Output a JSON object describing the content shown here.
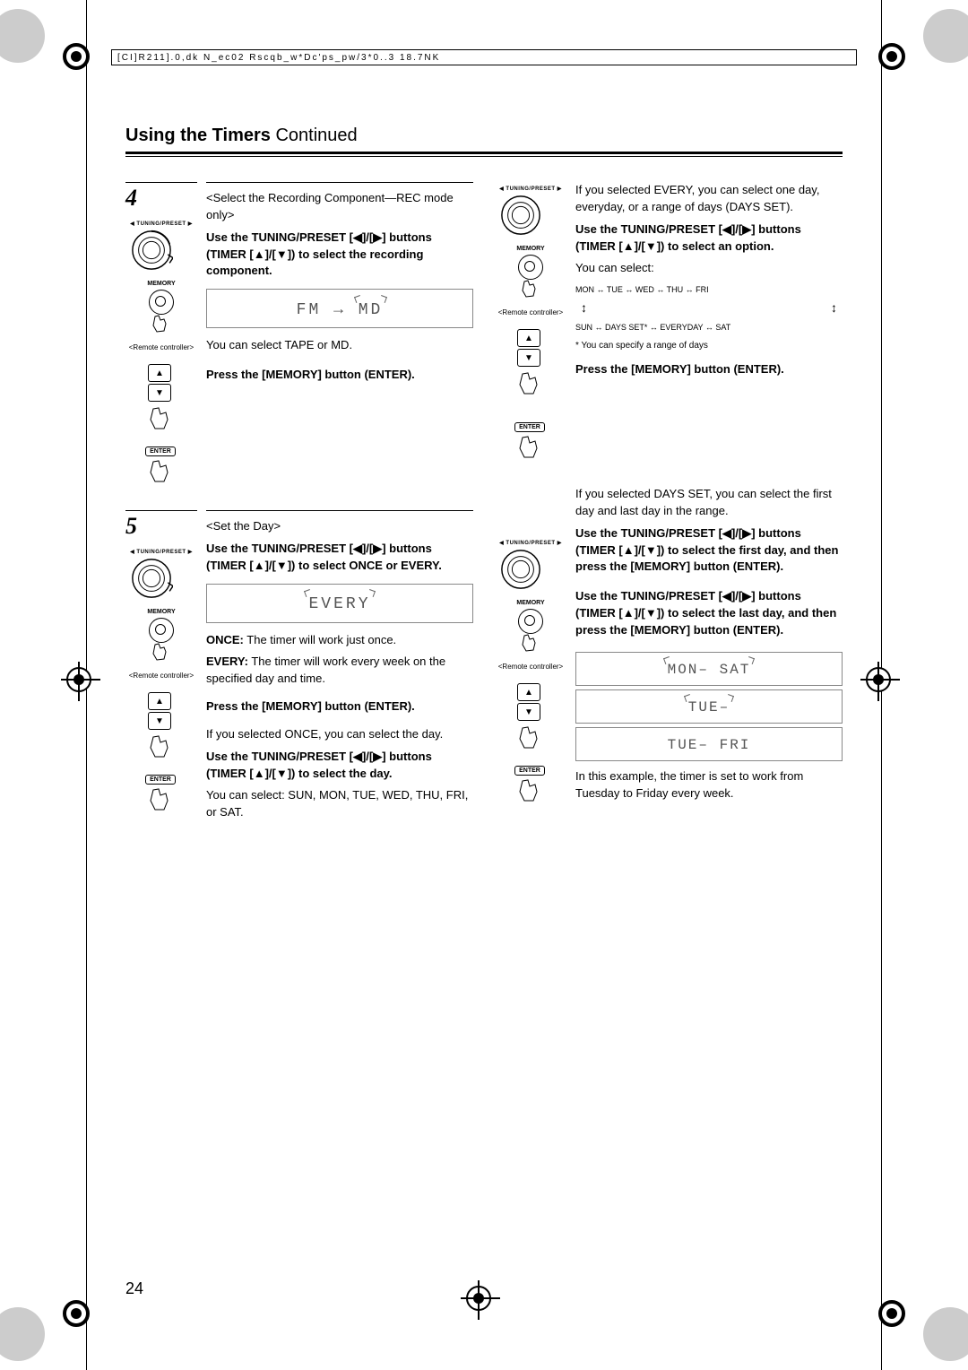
{
  "meta": {
    "filepath": "[CI]R211].0,dk N_ec02 Rscqb_w*Dc'ps_pw/3*0..3 18.7NK"
  },
  "header": {
    "title_bold": "Using the Timers",
    "title_cont": "Continued"
  },
  "step4": {
    "number": "4",
    "subtitle": "<Select the Recording Component—REC mode only>",
    "line1": "Use the TUNING/PRESET [◀]/[▶] buttons (TIMER [▲]/[▼]) to select the recording component.",
    "lcd1_left": "FM",
    "lcd1_arrow": "→",
    "lcd1_right": "MD",
    "note": "You can select TAPE or MD.",
    "press": "Press the [MEMORY] button (ENTER).",
    "tuning_label": "◀ TUNING/PRESET ▶",
    "memory_label": "MEMORY",
    "remote_label": "<Remote controller>",
    "enter_label": "ENTER"
  },
  "step5": {
    "number": "5",
    "subtitle": "<Set the Day>",
    "line1": "Use the TUNING/PRESET [◀]/[▶] buttons (TIMER [▲]/[▼]) to select ONCE or EVERY.",
    "lcd": "EVERY",
    "once_label": "ONCE:",
    "once_text": "The timer will work just once.",
    "every_label": "EVERY:",
    "every_text": "The timer will work every week on the specified day and time.",
    "press": "Press the [MEMORY] button (ENTER).",
    "once_sel": "If you selected ONCE, you can select the day.",
    "once_sel_bold": "Use the TUNING/PRESET [◀]/[▶] buttons (TIMER [▲]/[▼]) to select the day.",
    "once_sel_days": "You can select: SUN, MON, TUE, WED, THU, FRI, or SAT.",
    "tuning_label": "◀ TUNING/PRESET ▶",
    "memory_label": "MEMORY",
    "remote_label": "<Remote controller>",
    "enter_label": "ENTER"
  },
  "right_every": {
    "intro": "If you selected EVERY, you can select one day, everyday, or a range of days (DAYS SET).",
    "line1": "Use the TUNING/PRESET [◀]/[▶] buttons (TIMER [▲]/[▼]) to select an option.",
    "can_select": "You can select:",
    "days_row1": "MON ↔ TUE ↔ WED ↔ THU ↔ FRI",
    "days_row2": "SUN ↔ DAYS SET* ↔ EVERYDAY ↔ SAT",
    "footnote": "* You can specify a range of days",
    "press": "Press the [MEMORY] button (ENTER).",
    "tuning_label": "◀ TUNING/PRESET ▶",
    "memory_label": "MEMORY",
    "remote_label": "<Remote controller>",
    "enter_label": "ENTER"
  },
  "right_daysset": {
    "intro": "If you selected DAYS SET, you can select the first day and last day in the range.",
    "first": "Use the TUNING/PRESET [◀]/[▶] buttons (TIMER [▲]/[▼]) to select the first day, and then press the [MEMORY] button (ENTER).",
    "last": "Use the TUNING/PRESET [◀]/[▶] buttons (TIMER [▲]/[▼]) to select the last day, and then press the [MEMORY] button (ENTER).",
    "lcd1": "MON– SAT",
    "lcd2": "TUE–",
    "lcd3": "TUE– FRI",
    "example": "In this example, the timer is set to work from Tuesday to Friday every week.",
    "tuning_label": "◀ TUNING/PRESET ▶",
    "memory_label": "MEMORY",
    "remote_label": "<Remote controller>",
    "enter_label": "ENTER"
  },
  "page_number": "24"
}
